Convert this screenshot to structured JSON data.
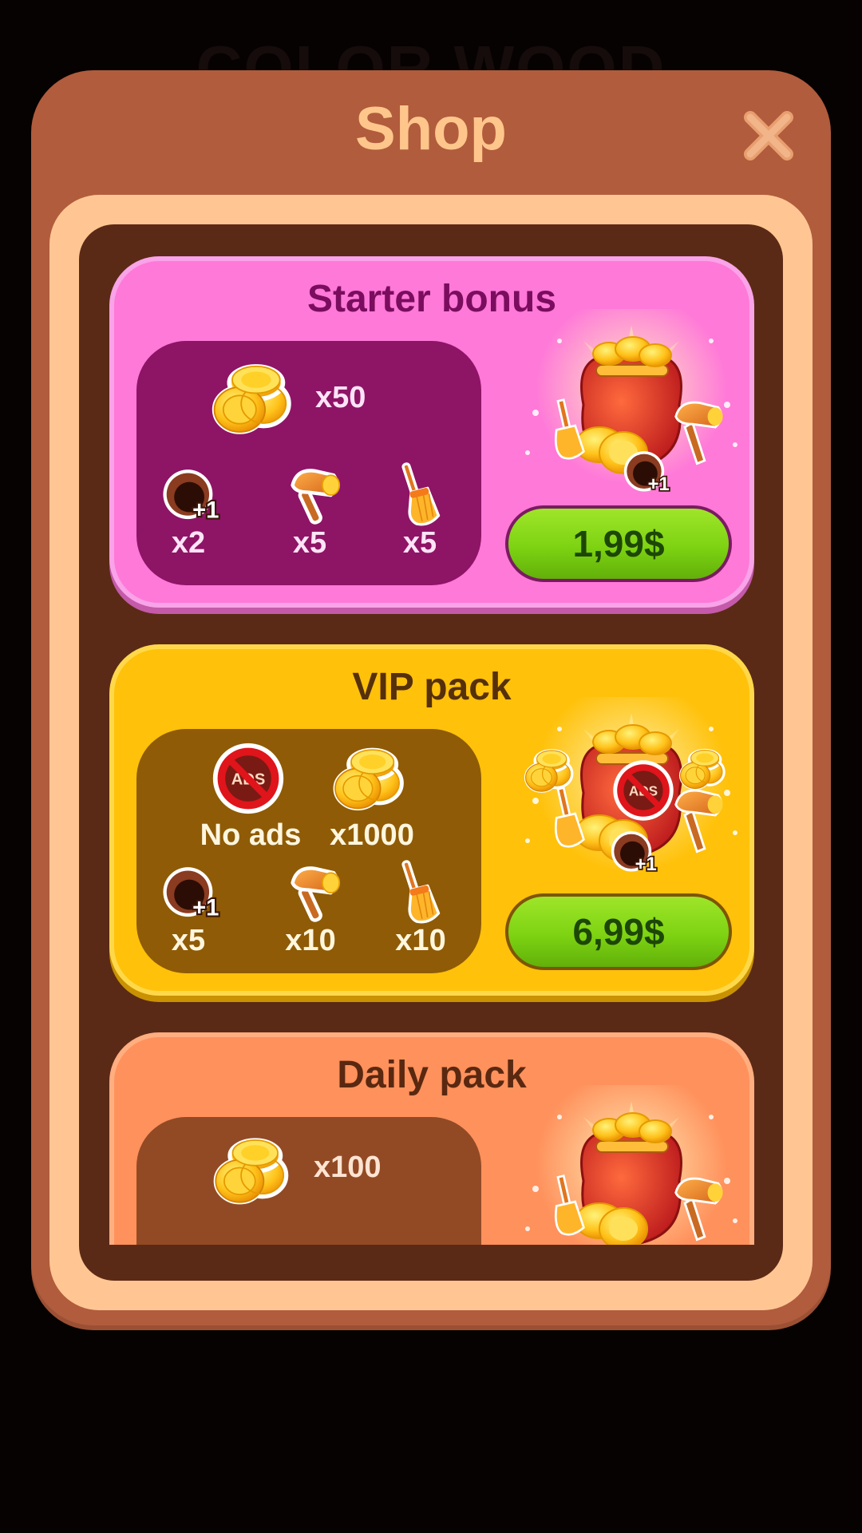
{
  "background_title": "COLOR WOOD",
  "dialog": {
    "title": "Shop",
    "close_icon": "close-x-icon"
  },
  "colors": {
    "starter_card": "#ff79d8",
    "vip_card": "#ffc10a",
    "daily_card": "#ff915c",
    "buy_button": "#7dd312",
    "dialog": "#b15c3c"
  },
  "packs": [
    {
      "title": "Starter bonus",
      "items": [
        {
          "icon": "coins-icon",
          "label": "x50"
        },
        {
          "icon": "hole-plus-one-icon",
          "label": "x2"
        },
        {
          "icon": "hammer-icon",
          "label": "x5"
        },
        {
          "icon": "broom-icon",
          "label": "x5"
        }
      ],
      "price": "1,99$"
    },
    {
      "title": "VIP pack",
      "items": [
        {
          "icon": "no-ads-icon",
          "label": "No ads"
        },
        {
          "icon": "coins-icon",
          "label": "x1000"
        },
        {
          "icon": "hole-plus-one-icon",
          "label": "x5"
        },
        {
          "icon": "hammer-icon",
          "label": "x10"
        },
        {
          "icon": "broom-icon",
          "label": "x10"
        }
      ],
      "price": "6,99$"
    },
    {
      "title": "Daily pack",
      "items": [
        {
          "icon": "coins-icon",
          "label": "x100"
        }
      ]
    }
  ],
  "badges": {
    "plus_one": "+1",
    "ads": "ADS"
  }
}
